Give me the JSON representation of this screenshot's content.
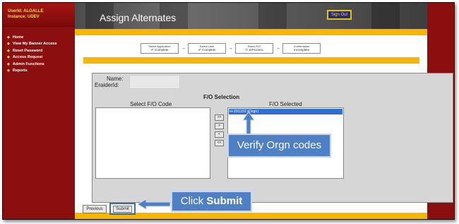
{
  "sidebar": {
    "user_line": "UserId: ALGALLE",
    "instance_line": "Instance: UDEV",
    "items": [
      {
        "label": "Home"
      },
      {
        "label": "View My Banner Access"
      },
      {
        "label": "Reset Password"
      },
      {
        "label": "Access Request"
      },
      {
        "label": "Admin Functions"
      },
      {
        "label": "Reports"
      }
    ]
  },
  "header": {
    "title": "Assign Alternates",
    "signout_label": "Sign Out"
  },
  "workflow": {
    "steps": [
      {
        "title": "Select Application",
        "status": "Complete",
        "icon": "check-icon"
      },
      {
        "title": "Select User",
        "status": "Complete",
        "icon": "check-icon"
      },
      {
        "title": "Select F/O",
        "status": "InProcess",
        "icon": "process-icon"
      },
      {
        "title": "Confirmation",
        "status": "Incomplete",
        "icon": ""
      }
    ]
  },
  "form": {
    "name_label": "Name:",
    "eraider_label": "EraiderId:",
    "fo_selection_title": "F/O Selection",
    "select_code_label": "Select F/O Code",
    "selected_label": "F/O Selected",
    "selected_items": [
      "H-201102 (Orgn)"
    ],
    "move_buttons": [
      ">>",
      ">",
      "<",
      "<<"
    ]
  },
  "buttons": {
    "previous": "Previous",
    "submit": "Submit"
  },
  "callouts": {
    "verify": "Verify Orgn codes",
    "click_prefix": "Click ",
    "click_bold": "Submit"
  },
  "colors": {
    "sidebar_red": "#8c0f0f",
    "gold": "#f7b600",
    "callout_blue": "#4f7fc4",
    "selection_blue": "#2f6ed3"
  }
}
